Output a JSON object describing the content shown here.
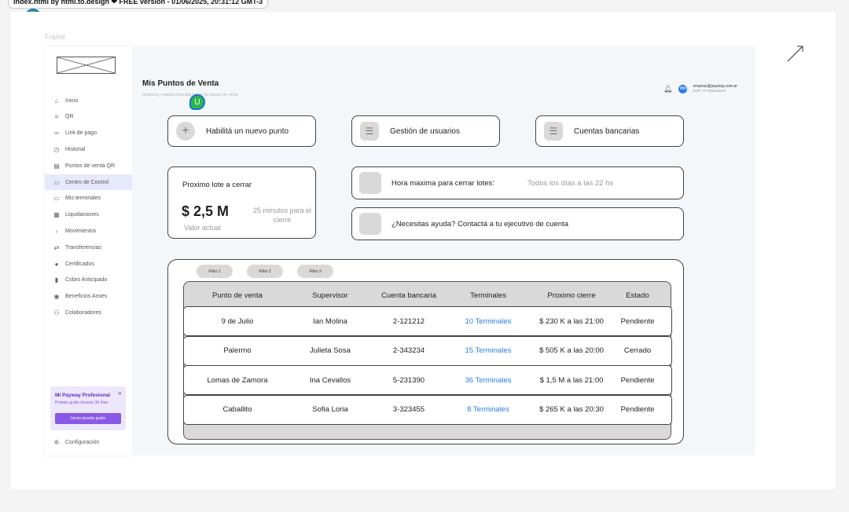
{
  "header_bar": {
    "text": "index.html by html.to.design ❤ FREE version - 01/06/2025, 20:31:12 GMT-3"
  },
  "collab_badge": "U",
  "frame_label": "Frame",
  "sidebar": {
    "items": [
      {
        "label": "Inicio",
        "icon": "home-icon",
        "glyph": "⌂"
      },
      {
        "label": "QR",
        "icon": "qr-icon",
        "glyph": "⌗"
      },
      {
        "label": "Link de pago",
        "icon": "link-icon",
        "glyph": "∞"
      },
      {
        "label": "Historial",
        "icon": "history-icon",
        "glyph": "◷"
      },
      {
        "label": "Puntos de venta QR",
        "icon": "store-icon",
        "glyph": "▤"
      },
      {
        "label": "Centro de Control",
        "icon": "control-icon",
        "glyph": "▭"
      },
      {
        "label": "Mis terminales",
        "icon": "terminal-icon",
        "glyph": "▭"
      },
      {
        "label": "Liquidaciones",
        "icon": "receipt-icon",
        "glyph": "▦"
      },
      {
        "label": "Movimientos",
        "icon": "chevron-right-icon",
        "glyph": "›"
      },
      {
        "label": "Transferencias",
        "icon": "transfer-icon",
        "glyph": "⇄"
      },
      {
        "label": "Certificados",
        "icon": "certificate-icon",
        "glyph": "●"
      },
      {
        "label": "Cobro Anticipado",
        "icon": "document-icon",
        "glyph": "▮"
      },
      {
        "label": "Beneficios Anses",
        "icon": "benefit-icon",
        "glyph": "◉"
      },
      {
        "label": "Colaboradores",
        "icon": "people-icon",
        "glyph": "⚇"
      }
    ],
    "active_index": 5,
    "promo": {
      "title": "Mi Payway Profesional",
      "subtitle": "Probalo gratis durante 30 días.",
      "button": "Iniciar prueba gratis",
      "close": "×"
    },
    "config": {
      "label": "Configuración",
      "glyph": "✲"
    }
  },
  "main": {
    "title": "Mis Puntos de Venta",
    "subtitle": "Gestioná y realizá consultas sobre tus puntos de venta",
    "user": {
      "initials": "MM",
      "email": "xmarraz@payway.com.ar",
      "cuit": "CUIT: 27-26111111-9"
    },
    "actions": [
      {
        "label": "Habilitá un nuevo punto",
        "glyph": "+"
      },
      {
        "label": "Gestión de usuarios",
        "glyph": "☰"
      },
      {
        "label": "Cuentas bancarias",
        "glyph": "☰"
      }
    ],
    "lote": {
      "title": "Proximo lote a cerrar",
      "amount": "$ 2,5 M",
      "amount_caption": "Valor actual",
      "time": "25 minutos para el cierre"
    },
    "info_cards": [
      {
        "label": "Hora maxima para cerrar lotes:",
        "value": "Todos los días a las 22 hs"
      },
      {
        "label": "¿Necesitas ayuda? Contactá a tu ejecutivo de cuenta",
        "value": ""
      }
    ],
    "filters": [
      "Filtro 1",
      "Filtro 2",
      "Filtro 3"
    ],
    "table": {
      "headers": [
        "Punto de venta",
        "Supervisor",
        "Cuenta bancaria",
        "Terminales",
        "Proximo cierre",
        "Estado"
      ],
      "rows": [
        [
          "9 de Julio",
          "Ian Molina",
          "2-121212",
          "10 Terminales",
          "$ 230 K a las 21:00",
          "Pendiente"
        ],
        [
          "Palermo",
          "Julieta Sosa",
          "2-343234",
          "15 Terminales",
          "$ 505 K a las 20:00",
          "Cerrado"
        ],
        [
          "Lomas de Zamora",
          "Ina Cevallos",
          "5-231390",
          "36 Terminales",
          "$ 1,5 M a las 21:00",
          "Pendiente"
        ],
        [
          "Caballito",
          "Sofia Loria",
          "3-323455",
          "8 Terminales",
          "$ 265 K a las 20:30",
          "Pendiente"
        ]
      ]
    }
  },
  "colors": {
    "accent": "#2a7de1",
    "promo": "#8a59e8",
    "active_nav": "#e6e9fb"
  }
}
